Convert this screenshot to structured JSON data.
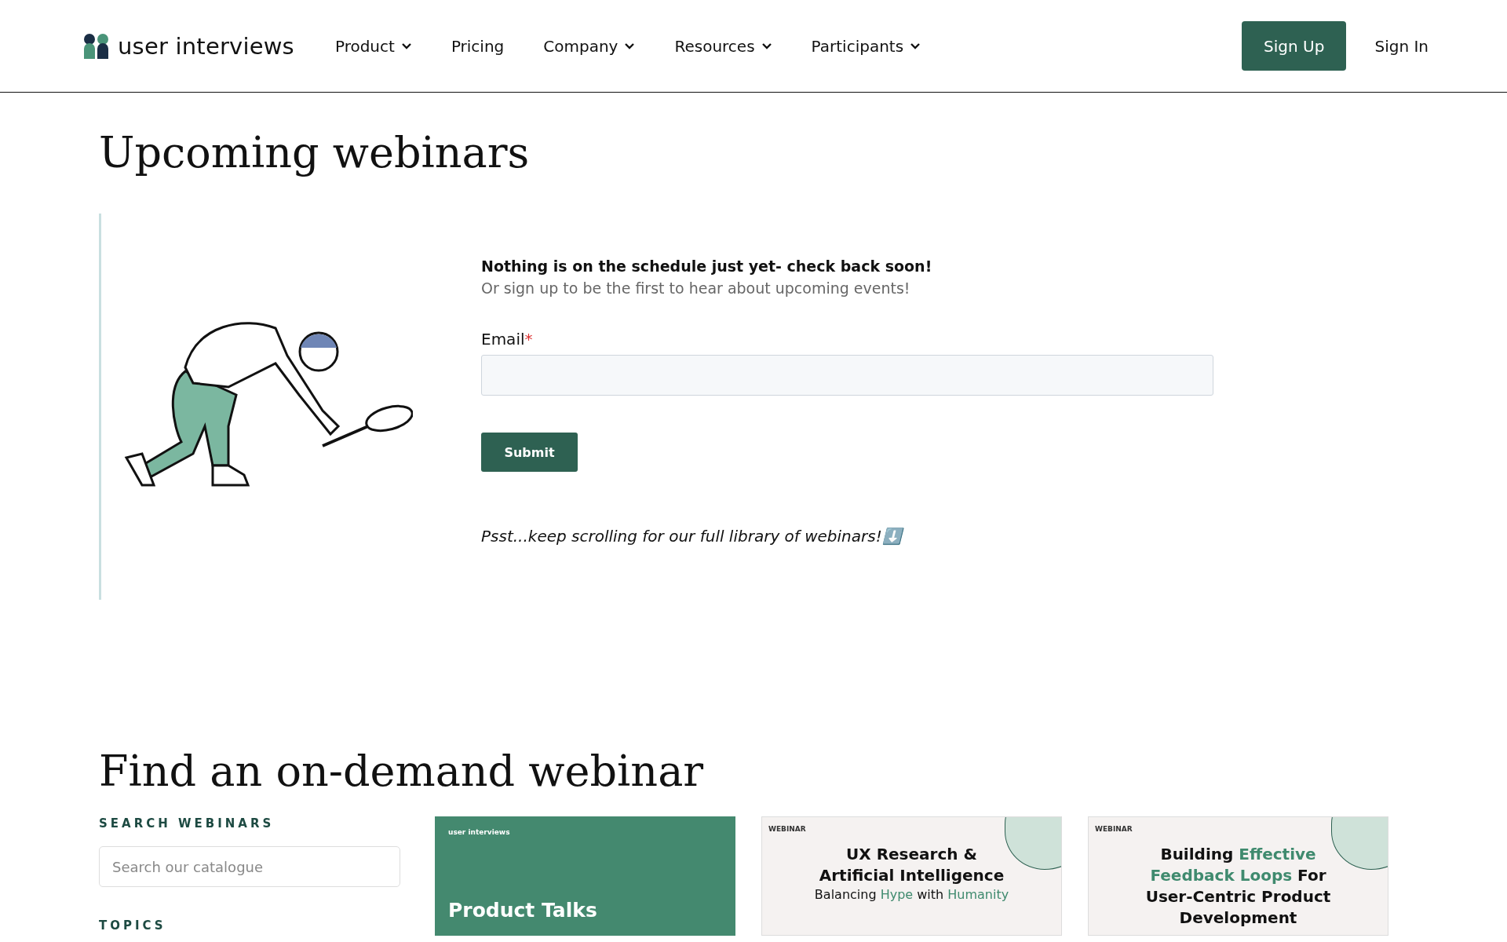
{
  "header": {
    "logo": "user interviews",
    "nav": [
      {
        "label": "Product",
        "dropdown": true
      },
      {
        "label": "Pricing",
        "dropdown": false
      },
      {
        "label": "Company",
        "dropdown": true
      },
      {
        "label": "Resources",
        "dropdown": true
      },
      {
        "label": "Participants",
        "dropdown": true
      }
    ],
    "sign_up": "Sign Up",
    "sign_in": "Sign In"
  },
  "upcoming": {
    "title": "Upcoming webinars",
    "notice": "Nothing is on the schedule just yet- check back soon!",
    "subtext": "Or sign up to be the first to hear about upcoming events!",
    "email_label": "Email",
    "required_mark": "*",
    "submit": "Submit",
    "scroll_hint": "Psst...keep scrolling for our full library of webinars!",
    "scroll_emoji": "⬇️"
  },
  "on_demand": {
    "title": "Find an on-demand webinar",
    "search_label": "SEARCH WEBINARS",
    "search_placeholder": "Search our catalogue",
    "topics_label": "TOPICS",
    "cards": [
      {
        "kind": "brand",
        "badge": "user interviews",
        "lines": [
          {
            "kind": "title",
            "segments": [
              {
                "text": "Product Talks",
                "highlight": false
              }
            ]
          }
        ]
      },
      {
        "kind": "webinar",
        "badge": "WEBINAR",
        "lines": [
          {
            "kind": "title",
            "segments": [
              {
                "text": "UX Research &",
                "highlight": false
              }
            ]
          },
          {
            "kind": "title",
            "segments": [
              {
                "text": "Artificial Intelligence",
                "highlight": false
              }
            ]
          },
          {
            "kind": "subtitle",
            "segments": [
              {
                "text": "Balancing ",
                "highlight": false
              },
              {
                "text": "Hype",
                "highlight": true
              },
              {
                "text": " with ",
                "highlight": false
              },
              {
                "text": "Humanity",
                "highlight": true
              }
            ]
          }
        ]
      },
      {
        "kind": "webinar",
        "badge": "WEBINAR",
        "lines": [
          {
            "kind": "title",
            "segments": [
              {
                "text": "Building ",
                "highlight": false
              },
              {
                "text": "Effective",
                "highlight": true
              }
            ]
          },
          {
            "kind": "title",
            "segments": [
              {
                "text": "Feedback Loops",
                "highlight": true
              },
              {
                "text": " For",
                "highlight": false
              }
            ]
          },
          {
            "kind": "title",
            "segments": [
              {
                "text": "User-Centric Product",
                "highlight": false
              }
            ]
          },
          {
            "kind": "title",
            "segments": [
              {
                "text": "Development",
                "highlight": false
              }
            ]
          }
        ]
      }
    ]
  }
}
